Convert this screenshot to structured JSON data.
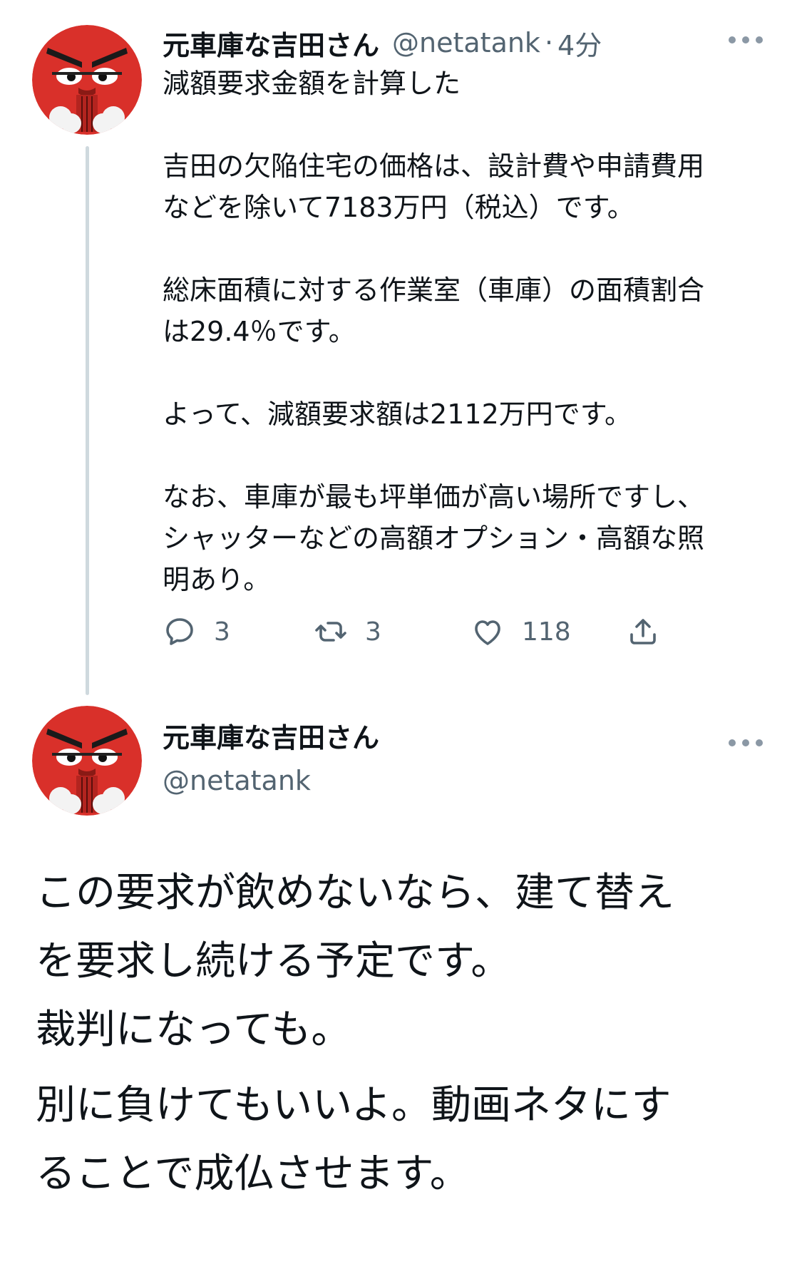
{
  "tweet1": {
    "author_name": "元車庫な吉田さん",
    "handle": "@netatank",
    "separator": "·",
    "time": "4分",
    "lines": [
      "減額要求金額を計算した",
      "",
      "吉田の欠陥住宅の価格は、設計費や申請費用",
      "などを除いて7183万円（税込）です。",
      "",
      "総床面積に対する作業室（車庫）の面積割合",
      "は29.4％です。",
      "",
      "よって、減額要求額は2112万円です。",
      "",
      "なお、車庫が最も坪単価が高い場所ですし、",
      "シャッターなどの高額オプション・高額な照",
      "明あり。"
    ],
    "reply_count": "3",
    "retweet_count": "3",
    "like_count": "118"
  },
  "tweet2": {
    "author_name": "元車庫な吉田さん",
    "handle": "@netatank",
    "lines": [
      "この要求が飲めないなら、建て替え",
      "を要求し続ける予定です。",
      "裁判になっても。"
    ],
    "lines2": [
      "別に負けてもいいよ。動画ネタにす",
      "ることで成仏させます。"
    ]
  },
  "icons": {
    "reply": "reply-icon",
    "retweet": "retweet-icon",
    "like": "heart-icon",
    "share": "share-icon",
    "more": "more-icon"
  },
  "colors": {
    "text": "#0f1419",
    "secondary": "#536471",
    "thread_line": "#cfd9de",
    "avatar_red": "#d9302a"
  }
}
